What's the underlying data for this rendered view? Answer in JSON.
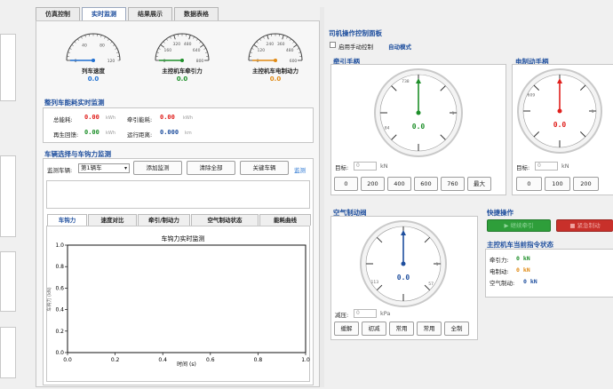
{
  "tabs": [
    {
      "label": "仿真控制"
    },
    {
      "label": "实时监测"
    },
    {
      "label": "结果展示"
    },
    {
      "label": "数据表格"
    }
  ],
  "gauges": [
    {
      "label": "列车速度",
      "value": "0.0",
      "color": "#1f6fd0",
      "ticks": [
        "0",
        "40",
        "80",
        "120"
      ]
    },
    {
      "label": "主控机车牵引力",
      "value": "0.0",
      "color": "#1e8f2a",
      "ticks": [
        "0",
        "160",
        "320",
        "480",
        "640",
        "800"
      ]
    },
    {
      "label": "主控机车电制动力",
      "value": "0.0",
      "color": "#e08a14",
      "ticks": [
        "0",
        "120",
        "240",
        "360",
        "480",
        "600"
      ]
    }
  ],
  "energy": {
    "title": "整列车能耗实时监测",
    "rows": [
      {
        "label": "总能耗:",
        "value": "0.00",
        "unit": "kWh",
        "color": "#e0201d"
      },
      {
        "label": "牵引能耗:",
        "value": "0.00",
        "unit": "kWh",
        "color": "#e0201d"
      },
      {
        "label": "再生回馈:",
        "value": "0.00",
        "unit": "kWh",
        "color": "#1e8f2a"
      },
      {
        "label": "运行距离:",
        "value": "0.000",
        "unit": "km",
        "color": "#1f4f9e"
      }
    ]
  },
  "vehicle": {
    "title": "车辆选择与车钩力监测",
    "monitor_label": "监测车辆:",
    "selected": "第1辆车",
    "add_btn": "添加监测",
    "clear_btn": "清除全部",
    "key_btn": "关键车辆",
    "link": "监测",
    "subtabs": [
      "车钩力",
      "速度对比",
      "牵引/制动力",
      "空气制动状态",
      "能耗曲线"
    ]
  },
  "chart_data": {
    "type": "line",
    "title": "车钩力实时监测",
    "xlabel": "时间 (s)",
    "ylabel": "车钩力 (kN)",
    "xlim": [
      0,
      1
    ],
    "ylim": [
      0,
      1
    ],
    "x_ticks": [
      "0.0",
      "0.2",
      "0.4",
      "0.6",
      "0.8",
      "1.0"
    ],
    "y_ticks": [
      "0.0",
      "0.2",
      "0.4",
      "0.6",
      "0.8",
      "1.0"
    ],
    "series": []
  },
  "driver": {
    "title": "司机操作控制面板",
    "manual_label": "启用手动控制",
    "mode": "自动模式",
    "traction": {
      "title": "牵引手柄",
      "value": "0.0",
      "target_label": "目标:",
      "target_placeholder": "0",
      "unit": "kN",
      "buttons": [
        "0",
        "200",
        "400",
        "600",
        "760",
        "最大"
      ],
      "max": "738",
      "color": "#1e8f2a"
    },
    "brake": {
      "title": "电制动手柄",
      "value": "0.0",
      "target_label": "目标:",
      "target_placeholder": "0",
      "unit": "kN",
      "buttons": [
        "0",
        "100",
        "200"
      ],
      "max": "609",
      "color": "#e0201d"
    },
    "air": {
      "title": "空气制动阀",
      "value": "0.0",
      "target_label": "减压:",
      "target_placeholder": "0",
      "unit": "kPa",
      "buttons": [
        "缓解",
        "初减",
        "常用",
        "常用",
        "全制"
      ],
      "color": "#1f4f9e"
    }
  },
  "quick": {
    "title": "快捷操作",
    "start_label": "▶ 继续牵引",
    "stop_label": "■ 紧急制动",
    "state_title": "主控机车当前指令状态",
    "states": [
      {
        "label": "牵引力:",
        "value": "0 kN",
        "color": "#1e8f2a"
      },
      {
        "label": "电制动:",
        "value": "0 kN",
        "color": "#e08a14"
      },
      {
        "label": "空气制动:",
        "value": "0 kN",
        "color": "#1f4f9e"
      }
    ]
  }
}
